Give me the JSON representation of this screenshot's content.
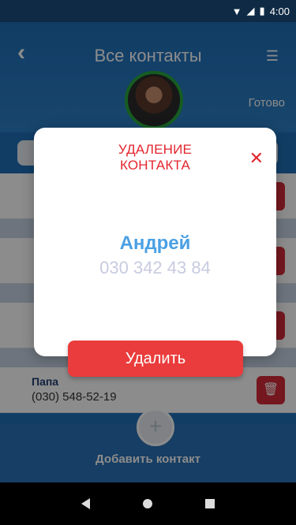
{
  "status_bar": {
    "time": "4:00",
    "wifi_icon": "wifi-icon",
    "signal_icon": "signal-icon",
    "battery_icon": "battery-icon"
  },
  "header": {
    "title": "Все контакты",
    "done_label": "Готово"
  },
  "list": {
    "rows": [
      {
        "name": "Папа",
        "phone": "(030) 548-52-19"
      }
    ]
  },
  "add_contact": {
    "label": "Добавить контакт",
    "plus": "+"
  },
  "modal": {
    "title_line1": "УДАЛЕНИЕ",
    "title_line2": "КОНТАКТА",
    "close_glyph": "✕",
    "contact_name": "Андрей",
    "contact_phone": "030 342 43 84",
    "delete_label": "Удалить"
  },
  "colors": {
    "accent_red": "#e3262f",
    "brand_blue": "#1f6fb8",
    "name_blue": "#4aa0e4"
  }
}
